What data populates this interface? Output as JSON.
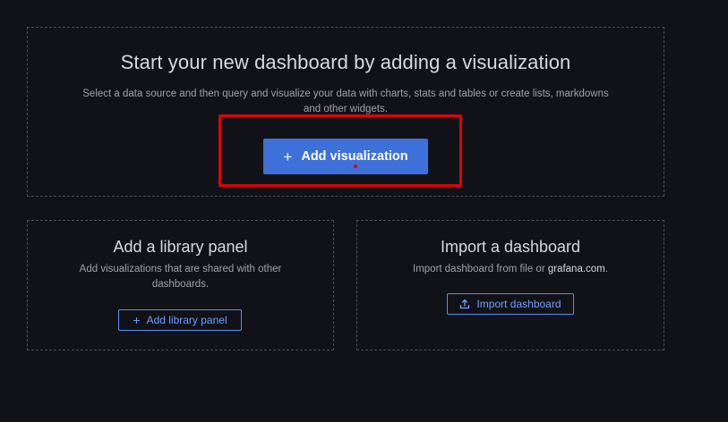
{
  "main": {
    "title": "Start your new dashboard by adding a visualization",
    "description": "Select a data source and then query and visualize your data with charts, stats and tables or create lists, markdowns and other widgets.",
    "add_visualization_label": "Add visualization",
    "add_icon": "plus-icon"
  },
  "library": {
    "title": "Add a library panel",
    "description": "Add visualizations that are shared with other dashboards.",
    "button_label": "Add library panel",
    "button_icon": "plus-icon"
  },
  "import": {
    "title": "Import a dashboard",
    "description_prefix": "Import dashboard from file or ",
    "description_link": "grafana.com",
    "description_suffix": ".",
    "button_label": "Import dashboard",
    "button_icon": "upload-icon"
  },
  "colors": {
    "background": "#111217",
    "primary_button": "#3d71d9",
    "outline_button": "#6e9fff",
    "highlight": "#e0000a"
  }
}
